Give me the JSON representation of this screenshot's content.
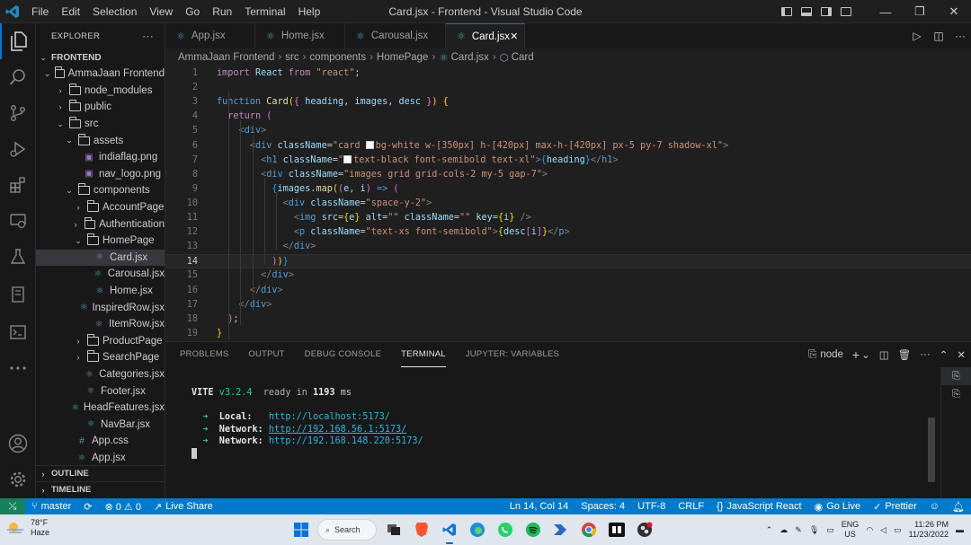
{
  "titlebar": {
    "menus": [
      "File",
      "Edit",
      "Selection",
      "View",
      "Go",
      "Run",
      "Terminal",
      "Help"
    ],
    "title": "Card.jsx - Frontend - Visual Studio Code"
  },
  "activity_icons": [
    "files-icon",
    "search-icon",
    "source-control-icon",
    "run-debug-icon",
    "extensions-icon",
    "remote-explorer-icon",
    "testing-icon",
    "notebook-icon",
    "terminal-icon",
    "more-icon",
    "account-icon",
    "settings-gear-icon"
  ],
  "explorer": {
    "header": "EXPLORER",
    "more": "···",
    "section": "FRONTEND",
    "items": [
      {
        "label": "AmmaJaan Frontend",
        "kind": "folder",
        "open": true
      },
      {
        "label": "node_modules",
        "kind": "folder",
        "open": false
      },
      {
        "label": "public",
        "kind": "folder",
        "open": false
      },
      {
        "label": "src",
        "kind": "folder",
        "open": true
      },
      {
        "label": "assets",
        "kind": "folder",
        "open": true
      },
      {
        "label": "indiaflag.png",
        "kind": "image"
      },
      {
        "label": "nav_logo.png",
        "kind": "image"
      },
      {
        "label": "components",
        "kind": "folder",
        "open": true
      },
      {
        "label": "AccountPage",
        "kind": "folder",
        "open": false
      },
      {
        "label": "Authentication",
        "kind": "folder",
        "open": false
      },
      {
        "label": "HomePage",
        "kind": "folder",
        "open": true
      },
      {
        "label": "Card.jsx",
        "kind": "jsx"
      },
      {
        "label": "Carousal.jsx",
        "kind": "jsx"
      },
      {
        "label": "Home.jsx",
        "kind": "jsx"
      },
      {
        "label": "InspiredRow.jsx",
        "kind": "jsx"
      },
      {
        "label": "ItemRow.jsx",
        "kind": "jsx"
      },
      {
        "label": "ProductPage",
        "kind": "folder",
        "open": false
      },
      {
        "label": "SearchPage",
        "kind": "folder",
        "open": false
      },
      {
        "label": "Categories.jsx",
        "kind": "jsx"
      },
      {
        "label": "Footer.jsx",
        "kind": "jsx"
      },
      {
        "label": "HeadFeatures.jsx",
        "kind": "jsx"
      },
      {
        "label": "NavBar.jsx",
        "kind": "jsx"
      },
      {
        "label": "App.css",
        "kind": "css"
      },
      {
        "label": "App.jsx",
        "kind": "jsx"
      }
    ],
    "outline": "OUTLINE",
    "timeline": "TIMELINE"
  },
  "tabs": [
    "App.jsx",
    "Home.jsx",
    "Carousal.jsx",
    "Card.jsx"
  ],
  "active_tab": "Card.jsx",
  "breadcrumb": [
    "AmmaJaan Frontend",
    "src",
    "components",
    "HomePage",
    "Card.jsx",
    "Card"
  ],
  "editor": {
    "current_line": 14,
    "lines": [
      [
        [
          "kw",
          "import"
        ],
        [
          "tx",
          " "
        ],
        [
          "var",
          "React"
        ],
        [
          "tx",
          " "
        ],
        [
          "kw",
          "from"
        ],
        [
          "tx",
          " "
        ],
        [
          "str",
          "\"react\""
        ],
        [
          "tx",
          ";"
        ]
      ],
      [],
      [
        [
          "kb",
          "function"
        ],
        [
          "tx",
          " "
        ],
        [
          "fn",
          "Card"
        ],
        [
          "br1",
          "("
        ],
        [
          "br2",
          "{"
        ],
        [
          "tx",
          " "
        ],
        [
          "var",
          "heading"
        ],
        [
          "tx",
          ", "
        ],
        [
          "var",
          "images"
        ],
        [
          "tx",
          ", "
        ],
        [
          "var",
          "desc"
        ],
        [
          "tx",
          " "
        ],
        [
          "br2",
          "}"
        ],
        [
          "br1",
          ")"
        ],
        [
          "tx",
          " "
        ],
        [
          "br1",
          "{"
        ]
      ],
      [
        [
          "tx",
          "  "
        ],
        [
          "kw",
          "return"
        ],
        [
          "tx",
          " "
        ],
        [
          "br2",
          "("
        ]
      ],
      [
        [
          "tx",
          "    "
        ],
        [
          "pn",
          "<"
        ],
        [
          "tg",
          "div"
        ],
        [
          "pn",
          ">"
        ]
      ],
      [
        [
          "tx",
          "      "
        ],
        [
          "pn",
          "<"
        ],
        [
          "tg",
          "div"
        ],
        [
          "tx",
          " "
        ],
        [
          "at",
          "className"
        ],
        [
          "tx",
          "="
        ],
        [
          "str",
          "\"card "
        ],
        [
          "sw",
          ""
        ],
        [
          "str",
          "bg-white w-[350px] h-[420px] max-h-[420px] px-5 py-7 shadow-xl\""
        ],
        [
          "pn",
          ">"
        ]
      ],
      [
        [
          "tx",
          "        "
        ],
        [
          "pn",
          "<"
        ],
        [
          "tg",
          "h1"
        ],
        [
          "tx",
          " "
        ],
        [
          "at",
          "className"
        ],
        [
          "tx",
          "="
        ],
        [
          "str",
          "\""
        ],
        [
          "sw",
          ""
        ],
        [
          "str",
          "text-black font-semibold text-xl\""
        ],
        [
          "pn",
          ">"
        ],
        [
          "br3",
          "{"
        ],
        [
          "var",
          "heading"
        ],
        [
          "br3",
          "}"
        ],
        [
          "pn",
          "</"
        ],
        [
          "tg",
          "h1"
        ],
        [
          "pn",
          ">"
        ]
      ],
      [
        [
          "tx",
          "        "
        ],
        [
          "pn",
          "<"
        ],
        [
          "tg",
          "div"
        ],
        [
          "tx",
          " "
        ],
        [
          "at",
          "className"
        ],
        [
          "tx",
          "="
        ],
        [
          "str",
          "\"images grid grid-cols-2 my-5 gap-7\""
        ],
        [
          "pn",
          ">"
        ]
      ],
      [
        [
          "tx",
          "          "
        ],
        [
          "br3",
          "{"
        ],
        [
          "var",
          "images"
        ],
        [
          "tx",
          "."
        ],
        [
          "fn",
          "map"
        ],
        [
          "br1",
          "("
        ],
        [
          "br2",
          "("
        ],
        [
          "var",
          "e"
        ],
        [
          "tx",
          ", "
        ],
        [
          "var",
          "i"
        ],
        [
          "br2",
          ")"
        ],
        [
          "tx",
          " "
        ],
        [
          "kb",
          "=>"
        ],
        [
          "tx",
          " "
        ],
        [
          "br2",
          "("
        ]
      ],
      [
        [
          "tx",
          "            "
        ],
        [
          "pn",
          "<"
        ],
        [
          "tg",
          "div"
        ],
        [
          "tx",
          " "
        ],
        [
          "at",
          "className"
        ],
        [
          "tx",
          "="
        ],
        [
          "str",
          "\"space-y-2\""
        ],
        [
          "pn",
          ">"
        ]
      ],
      [
        [
          "tx",
          "              "
        ],
        [
          "pn",
          "<"
        ],
        [
          "tg",
          "img"
        ],
        [
          "tx",
          " "
        ],
        [
          "at",
          "src"
        ],
        [
          "tx",
          "="
        ],
        [
          "br1",
          "{"
        ],
        [
          "var",
          "e"
        ],
        [
          "br1",
          "}"
        ],
        [
          "tx",
          " "
        ],
        [
          "at",
          "alt"
        ],
        [
          "tx",
          "="
        ],
        [
          "str",
          "\"\""
        ],
        [
          "tx",
          " "
        ],
        [
          "at",
          "className"
        ],
        [
          "tx",
          "="
        ],
        [
          "str",
          "\"\""
        ],
        [
          "tx",
          " "
        ],
        [
          "at",
          "key"
        ],
        [
          "tx",
          "="
        ],
        [
          "br1",
          "{"
        ],
        [
          "var",
          "i"
        ],
        [
          "br1",
          "}"
        ],
        [
          "tx",
          " "
        ],
        [
          "pn",
          "/>"
        ]
      ],
      [
        [
          "tx",
          "              "
        ],
        [
          "pn",
          "<"
        ],
        [
          "tg",
          "p"
        ],
        [
          "tx",
          " "
        ],
        [
          "at",
          "className"
        ],
        [
          "tx",
          "="
        ],
        [
          "str",
          "\"text-xs font-semibold\""
        ],
        [
          "pn",
          ">"
        ],
        [
          "br1",
          "{"
        ],
        [
          "var",
          "desc"
        ],
        [
          "br2",
          "["
        ],
        [
          "var",
          "i"
        ],
        [
          "br2",
          "]"
        ],
        [
          "br1",
          "}"
        ],
        [
          "pn",
          "</"
        ],
        [
          "tg",
          "p"
        ],
        [
          "pn",
          ">"
        ]
      ],
      [
        [
          "tx",
          "            "
        ],
        [
          "pn",
          "</"
        ],
        [
          "tg",
          "div"
        ],
        [
          "pn",
          ">"
        ]
      ],
      [
        [
          "tx",
          "          "
        ],
        [
          "br2",
          ")"
        ],
        [
          "br1",
          ")"
        ],
        [
          "br3",
          "}"
        ]
      ],
      [
        [
          "tx",
          "        "
        ],
        [
          "pn",
          "</"
        ],
        [
          "tg",
          "div"
        ],
        [
          "pn",
          ">"
        ]
      ],
      [
        [
          "tx",
          "      "
        ],
        [
          "pn",
          "</"
        ],
        [
          "tg",
          "div"
        ],
        [
          "pn",
          ">"
        ]
      ],
      [
        [
          "tx",
          "    "
        ],
        [
          "pn",
          "</"
        ],
        [
          "tg",
          "div"
        ],
        [
          "pn",
          ">"
        ]
      ],
      [
        [
          "tx",
          "  "
        ],
        [
          "br2",
          ")"
        ],
        [
          "tx",
          ";"
        ]
      ],
      [
        [
          "br1",
          "}"
        ]
      ]
    ]
  },
  "panel": {
    "tabs": [
      "PROBLEMS",
      "OUTPUT",
      "DEBUG CONSOLE",
      "TERMINAL",
      "JUPYTER: VARIABLES"
    ],
    "active": "TERMINAL",
    "shell": "node",
    "terminal": {
      "vite_name": "VITE",
      "vite_version": "v3.2.4",
      "ready_text": "ready in",
      "ready_ms": "1193",
      "ms_unit": "ms",
      "arrow": "➜",
      "local_label": "Local:",
      "local_url": "http://localhost:5173/",
      "network_label": "Network:",
      "network_url_1": "http://192.168.56.1:5173/",
      "network_url_2": "http://192.168.148.220:5173/"
    }
  },
  "statusbar": {
    "branch": "master",
    "problems": "⊗ 0 ⚠ 0",
    "live_share": "Live Share",
    "position": "Ln 14, Col 14",
    "spaces": "Spaces: 4",
    "encoding": "UTF-8",
    "eol": "CRLF",
    "language": "JavaScript React",
    "go_live": "Go Live",
    "prettier": "Prettier"
  },
  "taskbar": {
    "temp": "78°F",
    "weather": "Haze",
    "search": "Search",
    "lang_top": "ENG",
    "lang_bottom": "US",
    "time": "11:26 PM",
    "date": "11/23/2022"
  },
  "colors": {
    "accent": "#0078d4",
    "statusbar": "#007acc",
    "remote": "#16825d",
    "react_icon": "#519aba"
  }
}
